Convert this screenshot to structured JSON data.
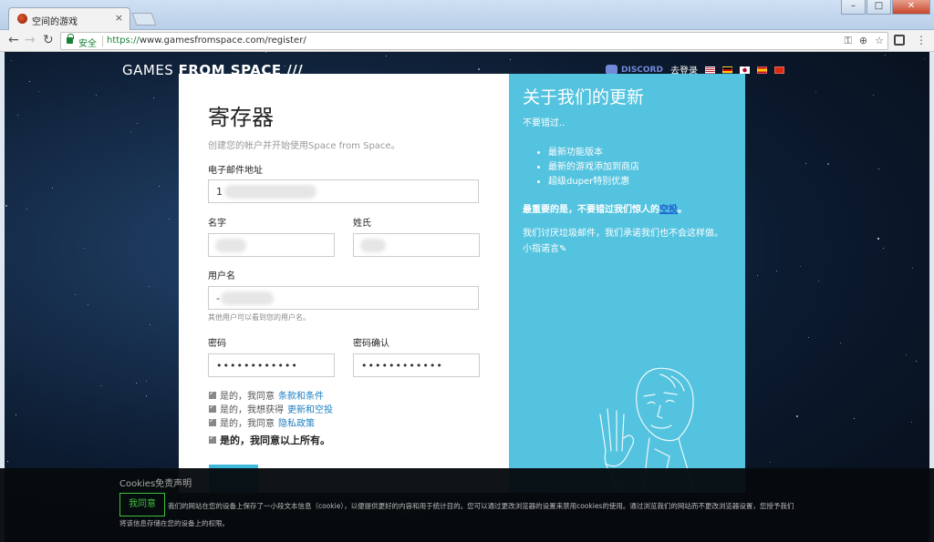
{
  "browser": {
    "tab_title": "空间的游戏",
    "tab_close": "×",
    "window_minimize": "–",
    "window_maximize": "□",
    "window_close": "✕",
    "secure_label": "安全",
    "url_scheme": "https://",
    "url_host": "www.gamesfromspace.com",
    "url_path": "/register/",
    "back_icon": "←",
    "forward_icon": "→",
    "reload_icon": "↻",
    "home_icon": "⌂",
    "key_icon": "⚿",
    "zoom_icon": "⊕",
    "star_icon": "☆",
    "menu_icon": "⋮"
  },
  "site": {
    "logo_games": "GAMES ",
    "logo_from": "FROM SPACE",
    "logo_slashes": " ///",
    "discord_label": "DISCORD",
    "login_label": "去登录"
  },
  "form": {
    "title": "寄存器",
    "subtitle": "创建您的帐户并开始使用Space from Space。",
    "email_label": "电子邮件地址",
    "email_value": "1",
    "first_name_label": "名字",
    "last_name_label": "姓氏",
    "username_label": "用户名",
    "username_value": "-",
    "username_hint": "其他用户可以看到您的用户名。",
    "password_label": "密码",
    "password_value": "••••••••••••",
    "password_confirm_label": "密码确认",
    "password_confirm_value": "••••••••••••",
    "checks": [
      {
        "prefix": "是的，我同意",
        "link": "条款和条件"
      },
      {
        "prefix": "是的，我想获得",
        "link": "更新和空投"
      },
      {
        "prefix": "是的，我同意",
        "link": "隐私政策"
      }
    ],
    "all_agree": "是的，我同意以上所有。"
  },
  "panel": {
    "title": "关于我们的更新",
    "lead": "不要错过..",
    "bullets": [
      "最新功能版本",
      "最新的游戏添加到商店",
      "超级duper特别优惠"
    ],
    "bold_text": "最重要的是，不要错过我们惊人的",
    "bold_link": "空投",
    "bold_end": "。",
    "promise": "我们讨厌垃圾邮件，我们承诺我们也不会这样做。小指诺言✎"
  },
  "cookie": {
    "title": "Cookies免责声明",
    "accept": "我同意",
    "text": "我们的网站在您的设备上保存了一小段文本信息（cookie），以便提供更好的内容和用于统计目的。您可以通过更改浏览器的设置来禁用cookies的使用。通过浏览我们的网站而不更改浏览器设置，您授予我们将该信息存储在您的设备上的权限。"
  },
  "colors": {
    "accent": "#53c3df",
    "link": "#1e7fc1",
    "accept_green": "#3fbf3f"
  }
}
